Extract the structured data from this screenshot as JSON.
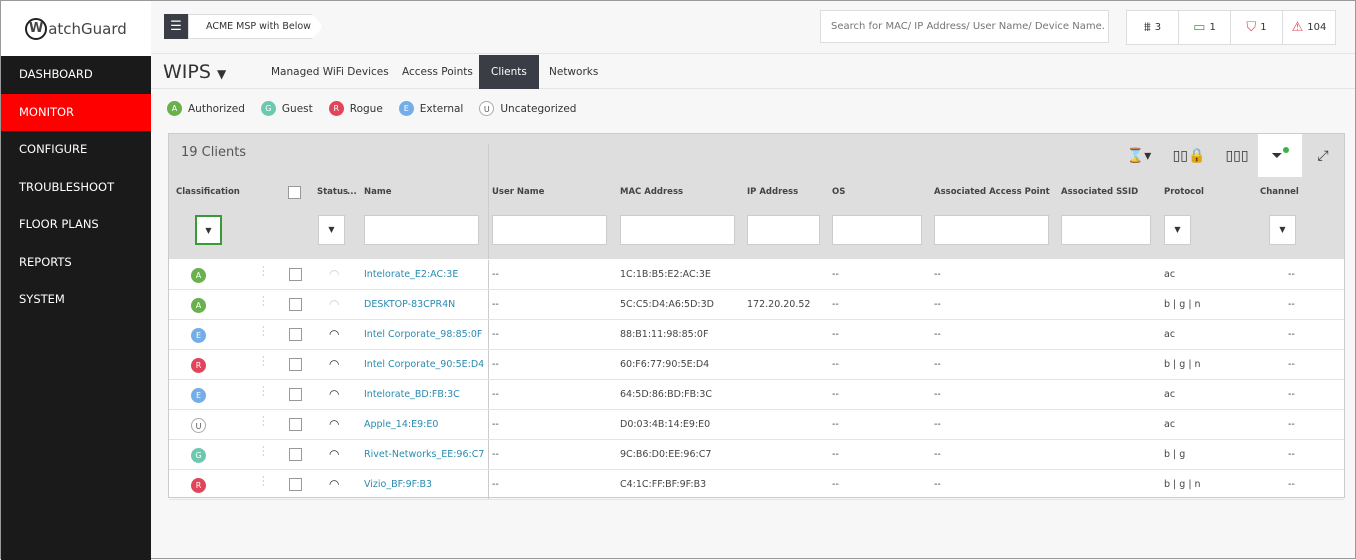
{
  "brand": {
    "logo": "WatchGuard"
  },
  "sidebar": {
    "items": [
      {
        "label": "DASHBOARD"
      },
      {
        "label": "MONITOR",
        "active": true
      },
      {
        "label": "CONFIGURE"
      },
      {
        "label": "TROUBLESHOOT"
      },
      {
        "label": "FLOOR PLANS"
      },
      {
        "label": "REPORTS"
      },
      {
        "label": "SYSTEM"
      }
    ]
  },
  "header": {
    "breadcrumb": "ACME MSP with Below ...",
    "search_placeholder": "Search for MAC/ IP Address/ User Name/ Device Name.",
    "stats": [
      {
        "icon": "access-point-icon",
        "value": "3"
      },
      {
        "icon": "laptop-icon",
        "value": "1",
        "color": "#3a9a3a"
      },
      {
        "icon": "shield-icon",
        "value": "1",
        "color": "#e0455a"
      },
      {
        "icon": "warning-icon",
        "value": "104",
        "color": "#e0455a"
      }
    ]
  },
  "subnav": {
    "title": "WIPS",
    "tabs": [
      {
        "label": "Managed WiFi Devices"
      },
      {
        "label": "Access Points"
      },
      {
        "label": "Clients",
        "active": true
      },
      {
        "label": "Networks"
      }
    ]
  },
  "legend": [
    {
      "letter": "A",
      "label": "Authorized",
      "color": "#6ab04c"
    },
    {
      "letter": "G",
      "label": "Guest",
      "color": "#6cc9b0"
    },
    {
      "letter": "R",
      "label": "Rogue",
      "color": "#e0455a"
    },
    {
      "letter": "E",
      "label": "External",
      "color": "#74aee8"
    },
    {
      "letter": "U",
      "label": "Uncategorized",
      "color": "#ffffff"
    }
  ],
  "table": {
    "count": "19 Clients",
    "columns": [
      "Classification",
      "Status",
      "...",
      "Name",
      "User Name",
      "MAC Address",
      "IP Address",
      "OS",
      "Associated Access Point",
      "Associated SSID",
      "Protocol",
      "Channel"
    ],
    "rows": [
      {
        "cls": "A",
        "signal": "weak",
        "name": "Intelorate_E2:AC:3E",
        "user": "--",
        "mac": "1C:1B:B5:E2:AC:3E",
        "ip": "",
        "os": "--",
        "ap": "--",
        "ssid": "",
        "protocol": "ac",
        "channel": "--"
      },
      {
        "cls": "A",
        "signal": "weak",
        "name": "DESKTOP-83CPR4N",
        "user": "--",
        "mac": "5C:C5:D4:A6:5D:3D",
        "ip": "172.20.20.52",
        "os": "--",
        "ap": "--",
        "ssid": "",
        "protocol": "b | g | n",
        "channel": "--"
      },
      {
        "cls": "E",
        "signal": "strong",
        "name": "Intel Corporate_98:85:0F",
        "user": "--",
        "mac": "88:B1:11:98:85:0F",
        "ip": "",
        "os": "--",
        "ap": "--",
        "ssid": "",
        "protocol": "ac",
        "channel": "--"
      },
      {
        "cls": "R",
        "signal": "strong",
        "name": "Intel Corporate_90:5E:D4",
        "user": "--",
        "mac": "60:F6:77:90:5E:D4",
        "ip": "",
        "os": "--",
        "ap": "--",
        "ssid": "",
        "protocol": "b | g | n",
        "channel": "--"
      },
      {
        "cls": "E",
        "signal": "strong",
        "name": "Intelorate_BD:FB:3C",
        "user": "--",
        "mac": "64:5D:86:BD:FB:3C",
        "ip": "",
        "os": "--",
        "ap": "--",
        "ssid": "",
        "protocol": "ac",
        "channel": "--"
      },
      {
        "cls": "U",
        "signal": "strong",
        "name": "Apple_14:E9:E0",
        "user": "--",
        "mac": "D0:03:4B:14:E9:E0",
        "ip": "",
        "os": "--",
        "ap": "--",
        "ssid": "",
        "protocol": "ac",
        "channel": "--"
      },
      {
        "cls": "G",
        "signal": "strong",
        "name": "Rivet-Networks_EE:96:C7",
        "user": "--",
        "mac": "9C:B6:D0:EE:96:C7",
        "ip": "",
        "os": "--",
        "ap": "--",
        "ssid": "",
        "protocol": "b | g",
        "channel": "--"
      },
      {
        "cls": "R",
        "signal": "strong",
        "name": "Vizio_BF:9F:B3",
        "user": "--",
        "mac": "C4:1C:FF:BF:9F:B3",
        "ip": "",
        "os": "--",
        "ap": "--",
        "ssid": "",
        "protocol": "b | g | n",
        "channel": "--"
      }
    ]
  }
}
